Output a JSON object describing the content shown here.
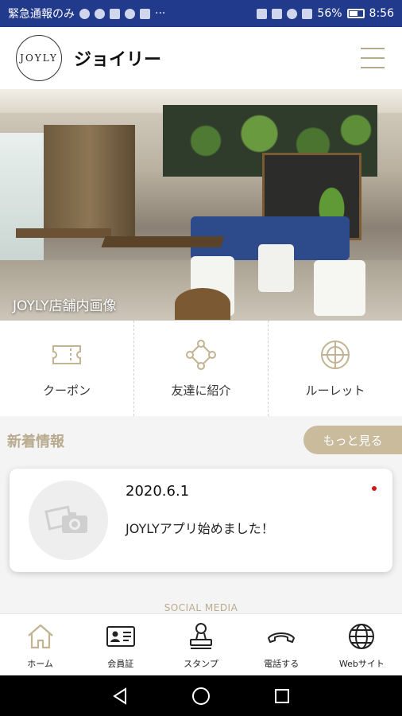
{
  "status_bar": {
    "left_text": "緊急通報のみ",
    "battery": "56%",
    "time": "8:56"
  },
  "header": {
    "logo_text": "JOYLY",
    "title": "ジョイリー",
    "menu_icon": "hamburger-icon"
  },
  "hero": {
    "caption": "JOYLY店舗内画像"
  },
  "quick_menu": [
    {
      "label": "クーポン",
      "icon": "ticket-icon"
    },
    {
      "label": "友達に紹介",
      "icon": "share-nodes-icon"
    },
    {
      "label": "ルーレット",
      "icon": "roulette-icon"
    }
  ],
  "news": {
    "title": "新着情報",
    "more_label": "もっと見る",
    "items": [
      {
        "date": "2020.6.1",
        "text": "JOYLYアプリ始めました！",
        "unread": true
      }
    ]
  },
  "social_label": "SOCIAL MEDIA",
  "tabs": [
    {
      "label": "ホーム",
      "icon": "home-icon"
    },
    {
      "label": "会員証",
      "icon": "member-card-icon"
    },
    {
      "label": "スタンプ",
      "icon": "stamp-icon"
    },
    {
      "label": "電話する",
      "icon": "phone-icon"
    },
    {
      "label": "Webサイト",
      "icon": "globe-icon"
    }
  ],
  "colors": {
    "status_bar": "#223a8c",
    "accent_gold": "#c9bb9c",
    "news_title": "#b9ab8e",
    "unread_dot": "#d01818"
  }
}
